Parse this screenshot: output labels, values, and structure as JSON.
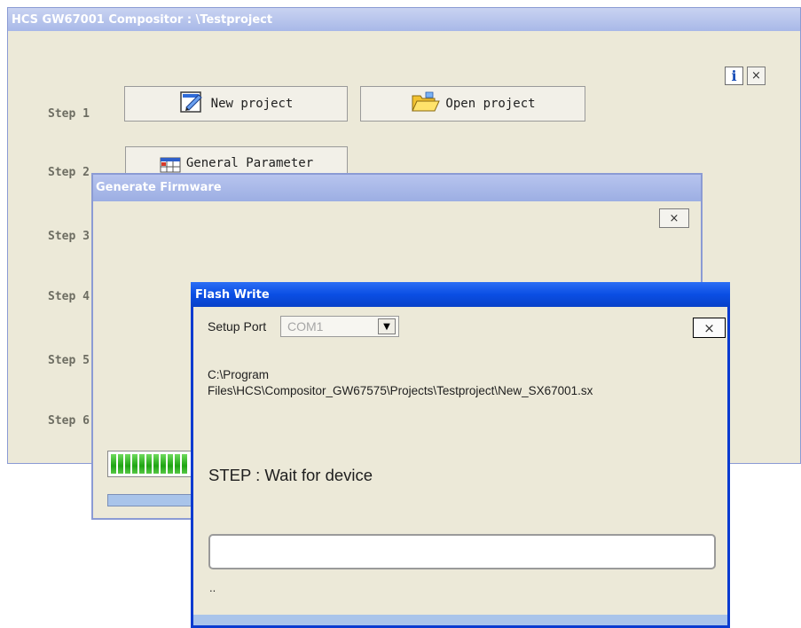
{
  "main": {
    "title": "HCS GW67001 Compositor : \\Testproject",
    "steps": [
      "Step 1",
      "Step 2",
      "Step 3",
      "Step 4",
      "Step 5",
      "Step 6"
    ],
    "new_project_label": "New project",
    "open_project_label": "Open project",
    "general_parameter_label": "General Parameter",
    "info_label": "i",
    "close_label": "×"
  },
  "generate": {
    "title": "Generate Firmware",
    "close_label": "×"
  },
  "flash": {
    "title": "Flash Write",
    "setup_port_label": "Setup Port",
    "port_value": "COM1",
    "close_label": "×",
    "path_line1": "C:\\Program",
    "path_line2": "Files\\HCS\\Compositor_GW67575\\Projects\\Testproject\\New_SX67001.sx",
    "step_text": "STEP : Wait for device",
    "status_text": ".."
  },
  "colors": {
    "xp_blue_title": "#0a4ee4",
    "inactive_title": "#a8b8e8",
    "window_bg": "#ece9d8",
    "progress_green": "#1ea512"
  }
}
